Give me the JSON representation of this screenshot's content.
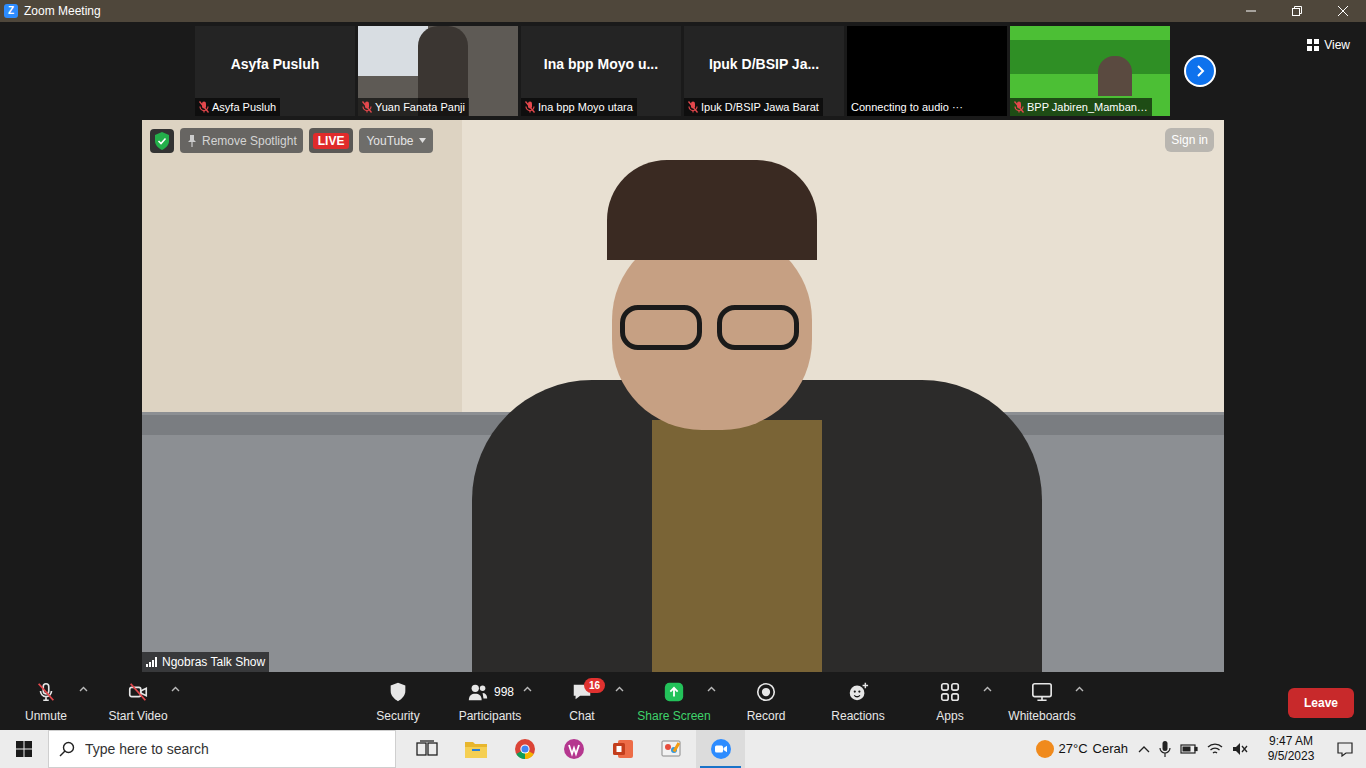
{
  "window": {
    "title": "Zoom Meeting",
    "app_icon": "Z"
  },
  "gallery": {
    "view_label": "View",
    "tiles": [
      {
        "name": "Asyfa Pusluh",
        "caption": "Asyfa Pusluh",
        "muted": true,
        "kind": "name"
      },
      {
        "caption": "Yuan Fanata Panji",
        "muted": true,
        "kind": "camera"
      },
      {
        "name": "Ina bpp Moyo u...",
        "caption": "Ina bpp Moyo utara",
        "muted": true,
        "kind": "name"
      },
      {
        "name": "Ipuk D/BSIP Ja...",
        "caption": "Ipuk D/BSIP Jawa Barat",
        "muted": true,
        "kind": "name"
      },
      {
        "caption": "Connecting to audio ···",
        "muted": false,
        "kind": "blank"
      },
      {
        "caption": "BPP Jabiren_Mamban…",
        "muted": true,
        "kind": "banner"
      }
    ]
  },
  "spotlight": {
    "secure": true,
    "remove_label": "Remove Spotlight",
    "live_badge": "LIVE",
    "stream_label": "YouTube",
    "sign_in": "Sign in",
    "speaker": "Ngobras Talk Show"
  },
  "toolbar": {
    "items": [
      {
        "label": "Unmute",
        "kind": "mic",
        "muted": true,
        "menu": true
      },
      {
        "label": "Start Video",
        "kind": "video",
        "muted": true,
        "menu": true
      },
      {
        "label": "Security",
        "kind": "security",
        "menu": false
      },
      {
        "label": "Participants",
        "kind": "participants",
        "count": "998",
        "menu": true
      },
      {
        "label": "Chat",
        "kind": "chat",
        "badge": "16",
        "menu": true
      },
      {
        "label": "Share Screen",
        "kind": "share",
        "menu": true
      },
      {
        "label": "Record",
        "kind": "record",
        "menu": false
      },
      {
        "label": "Reactions",
        "kind": "reactions",
        "menu": false
      },
      {
        "label": "Apps",
        "kind": "apps",
        "menu": true
      },
      {
        "label": "Whiteboards",
        "kind": "whiteboards",
        "menu": true
      }
    ],
    "leave": "Leave"
  },
  "taskbar": {
    "search_placeholder": "Type here to search",
    "apps": [
      {
        "kind": "task-view",
        "active": false
      },
      {
        "kind": "file-explorer",
        "active": false
      },
      {
        "kind": "chrome",
        "active": false
      },
      {
        "kind": "wps",
        "active": false
      },
      {
        "kind": "powerpoint",
        "active": false
      },
      {
        "kind": "paint",
        "active": false
      },
      {
        "kind": "zoom",
        "active": true
      }
    ],
    "weather": {
      "temp": "27°C",
      "condition": "Cerah"
    },
    "clock": {
      "time": "9:47 AM",
      "date": "9/5/2023"
    }
  }
}
